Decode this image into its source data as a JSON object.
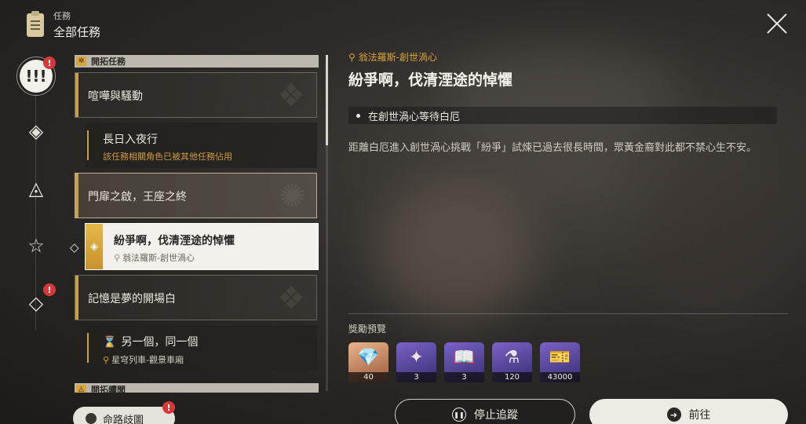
{
  "header": {
    "section_label": "任務",
    "title": "全部任務"
  },
  "rail": [
    {
      "icon": "!!!",
      "badge": "!"
    },
    {
      "icon": "◈"
    },
    {
      "icon": "◬"
    },
    {
      "icon": "☆"
    },
    {
      "icon": "◇",
      "badge": "!"
    }
  ],
  "list": {
    "category_1": {
      "icon": "✲",
      "label": "開拓任務"
    },
    "quest_1": {
      "title": "喧嘩與騷動"
    },
    "sub_1": {
      "title": "長日入夜行",
      "note": "該任務相關角色已被其他任務佔用"
    },
    "quest_2": {
      "title": "門扉之啟，王座之終"
    },
    "selected": {
      "title": "紛爭啊，伐清湮途的悼懼",
      "location": "翁法羅斯-創世渦心"
    },
    "quest_3": {
      "title": "記憶是夢的開場白"
    },
    "sub_2": {
      "title": "另一個，同一個",
      "location": "星穹列車-觀景車廂"
    },
    "category_2": {
      "icon": "◬",
      "label": "開拓續聞"
    }
  },
  "detail": {
    "location": "翁法羅斯-創世渦心",
    "title": "紛爭啊，伐清湮途的悼懼",
    "objective": "在創世渦心等待白厄",
    "description": "距離白厄進入創世渦心挑戰「紛爭」試煉已過去很長時間，眾黃金裔對此都不禁心生不安。"
  },
  "rewards": {
    "title": "獎勵預覽",
    "items": [
      {
        "icon": "crystal-icon",
        "count": "40",
        "style": "orange"
      },
      {
        "icon": "crystal-purple-icon",
        "count": "3",
        "style": "purple"
      },
      {
        "icon": "book-icon",
        "count": "3",
        "style": "purple"
      },
      {
        "icon": "potion-icon",
        "count": "120",
        "style": "purple"
      },
      {
        "icon": "ticket-icon",
        "count": "43000",
        "style": "purple"
      }
    ]
  },
  "buttons": {
    "path": "命路歧圖",
    "path_badge": "!",
    "stop": "停止追蹤",
    "go": "前往"
  }
}
